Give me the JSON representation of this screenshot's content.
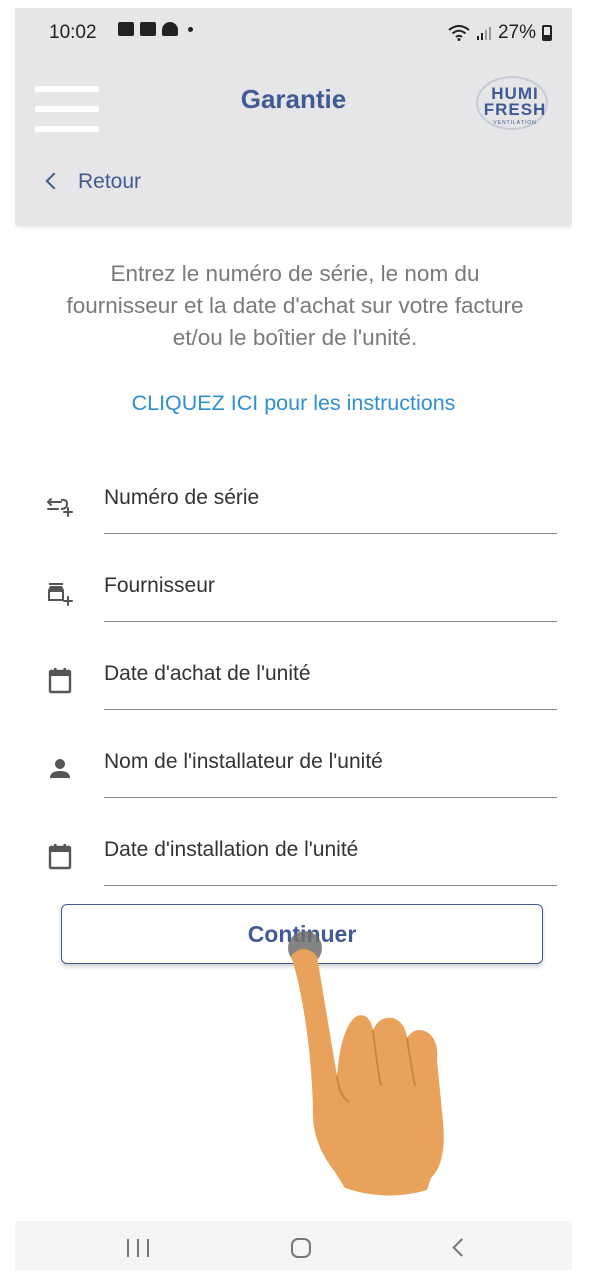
{
  "status_bar": {
    "time": "10:02",
    "battery": "27%"
  },
  "app_bar": {
    "title": "Garantie",
    "logo_line1": "HUMI",
    "logo_line2": "FRESH",
    "logo_line3": "VENTILATION"
  },
  "back": {
    "label": "Retour"
  },
  "intro": {
    "text": "Entrez le numéro de série, le nom du fournisseur et la date d'achat sur votre facture et/ou le boîtier de l'unité."
  },
  "instructions_link": "CLIQUEZ ICI pour les instructions",
  "fields": [
    {
      "label": "Numéro de série",
      "icon": "serial-number-icon"
    },
    {
      "label": "Fournisseur",
      "icon": "store-add-icon"
    },
    {
      "label": "Date d'achat de l'unité",
      "icon": "calendar-icon"
    },
    {
      "label": "Nom de l'installateur de l'unité",
      "icon": "person-icon"
    },
    {
      "label": "Date d'installation de l'unité",
      "icon": "calendar-icon"
    }
  ],
  "continue_button": "Continuer",
  "colors": {
    "brand": "#3f5a94",
    "link": "#2f8fcf",
    "bar_bg": "#e6e6e9",
    "hand": "#e9a25b"
  }
}
